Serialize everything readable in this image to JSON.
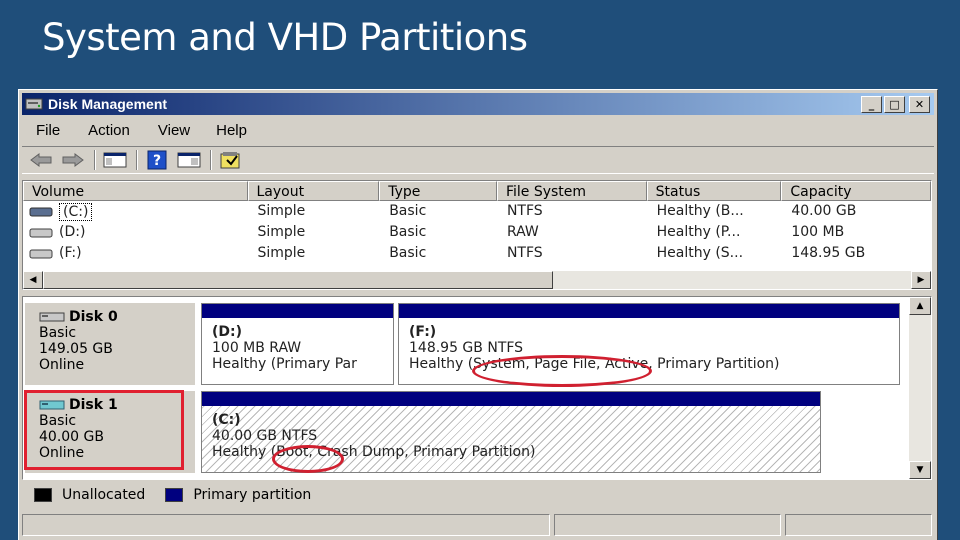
{
  "slide": {
    "title": "System and VHD Partitions"
  },
  "window": {
    "title": "Disk Management",
    "buttons": {
      "minimize": "_",
      "maximize": "□",
      "close": "✕"
    }
  },
  "menu": [
    "File",
    "Action",
    "View",
    "Help"
  ],
  "volume_table": {
    "columns": [
      "Volume",
      "Layout",
      "Type",
      "File System",
      "Status",
      "Capacity"
    ],
    "rows": [
      {
        "volume": "(C:)",
        "layout": "Simple",
        "type": "Basic",
        "fs": "NTFS",
        "status": "Healthy (B...",
        "capacity": "40.00 GB",
        "selected": true
      },
      {
        "volume": "(D:)",
        "layout": "Simple",
        "type": "Basic",
        "fs": "RAW",
        "status": "Healthy (P...",
        "capacity": "100 MB",
        "selected": false
      },
      {
        "volume": "(F:)",
        "layout": "Simple",
        "type": "Basic",
        "fs": "NTFS",
        "status": "Healthy (S...",
        "capacity": "148.95 GB",
        "selected": false
      }
    ]
  },
  "disks": [
    {
      "name": "Disk 0",
      "type": "Basic",
      "size": "149.05 GB",
      "state": "Online",
      "partitions": [
        {
          "name": "(D:)",
          "size_fs": "100 MB RAW",
          "status": "Healthy (Primary Par"
        },
        {
          "name": "(F:)",
          "size_fs": "148.95 GB NTFS",
          "status": "Healthy (System, Page File, Active, Primary Partition)"
        }
      ]
    },
    {
      "name": "Disk 1",
      "type": "Basic",
      "size": "40.00 GB",
      "state": "Online",
      "partitions": [
        {
          "name": "(C:)",
          "size_fs": "40.00 GB NTFS",
          "status": "Healthy (Boot, Crash Dump, Primary Partition)"
        }
      ]
    }
  ],
  "legend": [
    {
      "label": "Unallocated",
      "color": "#000000"
    },
    {
      "label": "Primary partition",
      "color": "#00007f"
    }
  ],
  "colors": {
    "background": "#1f4e7a",
    "highlight": "#d02030",
    "partition_bar": "#00007f"
  }
}
